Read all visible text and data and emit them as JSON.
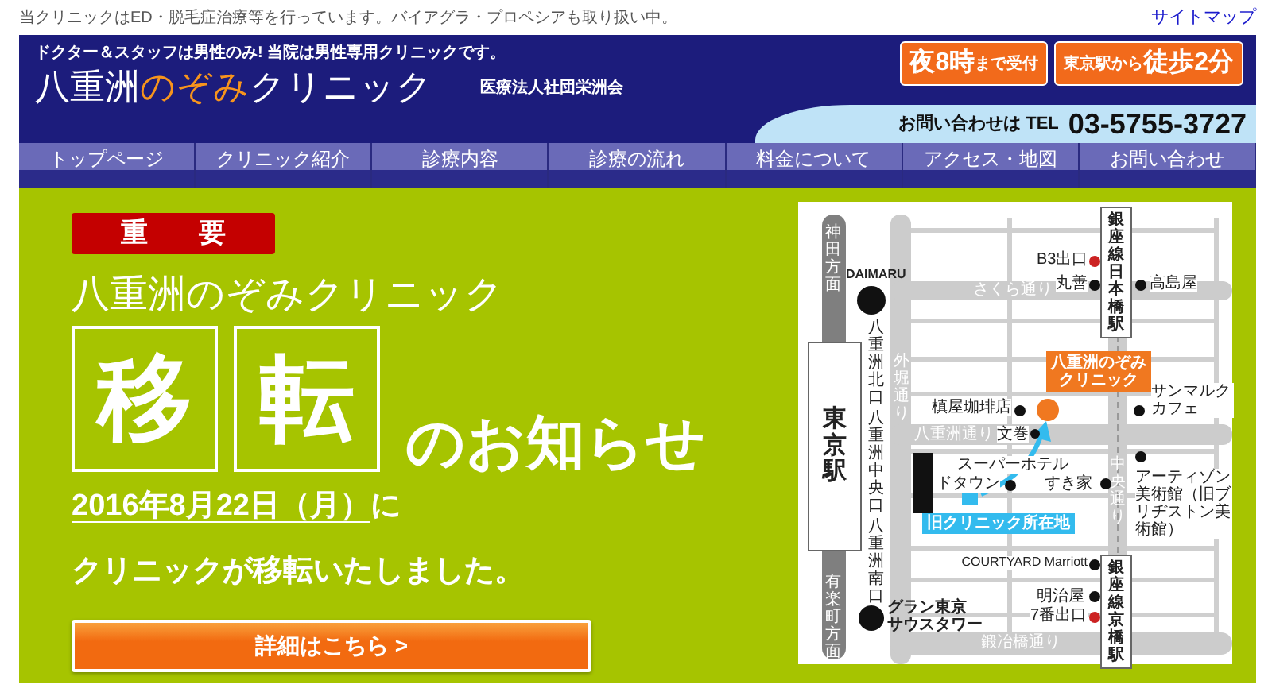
{
  "top_bar": {
    "notice": "当クリニックはED・脱毛症治療等を行っています。バイアグラ・プロペシアも取り扱い中。",
    "sitemap_link": "サイトマップ"
  },
  "header": {
    "tagline": "ドクター＆スタッフは男性のみ! 当院は男性専用クリニックです。",
    "logo": [
      {
        "text": "八重洲",
        "accent": false
      },
      {
        "text": "のぞみ",
        "accent": true
      },
      {
        "text": "クリニック",
        "accent": false
      }
    ],
    "corporation": "医療法人社団栄洲会",
    "badges": [
      {
        "parts": [
          {
            "text": "夜8時",
            "emphasis": true
          },
          {
            "text": "まで受付",
            "emphasis": false
          }
        ]
      },
      {
        "parts": [
          {
            "text": "東京駅から",
            "emphasis": false
          },
          {
            "text": "徒歩2分",
            "emphasis": true
          }
        ]
      }
    ],
    "phone": {
      "label": "お問い合わせは TEL",
      "number": "03-5755-3727"
    }
  },
  "nav": [
    "トップページ",
    "クリニック紹介",
    "診療内容",
    "診療の流れ",
    "料金について",
    "アクセス・地図",
    "お問い合わせ"
  ],
  "banner": {
    "tag": "重 要",
    "clinic_name": "八重洲のぞみクリニック",
    "boxed_chars": [
      "移",
      "転"
    ],
    "headline_rest": "のお知らせ",
    "date": "2016年8月22日（月）",
    "date_suffix": "に",
    "message": "クリニックが移転いたしました。",
    "details_button": "詳細はこちら >",
    "map": {
      "labels": [
        {
          "text": "神田方面",
          "kind": "direction"
        },
        {
          "text": "DAIMARU",
          "kind": "landmark",
          "color": "#111111"
        },
        {
          "text": "八重洲北口",
          "kind": "exit"
        },
        {
          "text": "東京駅",
          "kind": "station-main"
        },
        {
          "text": "八重洲中央口",
          "kind": "exit"
        },
        {
          "text": "八重洲南口",
          "kind": "exit"
        },
        {
          "text": "有楽町方面",
          "kind": "direction"
        },
        {
          "text": "グラン東京",
          "kind": "landmark",
          "color": "#111111"
        },
        {
          "text": "サウスタワー",
          "kind": "landmark"
        },
        {
          "text": "さくら通り",
          "kind": "road"
        },
        {
          "text": "外堀通り",
          "kind": "road-vertical"
        },
        {
          "text": "八重洲通り",
          "kind": "road"
        },
        {
          "text": "中央通り",
          "kind": "road-vertical"
        },
        {
          "text": "鍛冶橋通り",
          "kind": "road"
        },
        {
          "text": "銀座線日本橋駅",
          "kind": "station"
        },
        {
          "text": "B3出口",
          "kind": "place",
          "color": "#cc2222"
        },
        {
          "text": "丸善",
          "kind": "place",
          "color": "#111111"
        },
        {
          "text": "高島屋",
          "kind": "place",
          "color": "#111111"
        },
        {
          "text": "八重洲のぞみクリニック",
          "kind": "clinic",
          "color": "#f07820"
        },
        {
          "text": "槙屋珈琲店",
          "kind": "place",
          "color": "#111111"
        },
        {
          "text": "文巻",
          "kind": "place",
          "color": "#111111"
        },
        {
          "text": "サンマルクカフェ",
          "kind": "place",
          "color": "#111111"
        },
        {
          "text": "スーパーホテル",
          "kind": "place",
          "color": "#111111"
        },
        {
          "text": "ドタウン",
          "kind": "place"
        },
        {
          "text": "すき家",
          "kind": "place",
          "color": "#111111"
        },
        {
          "text": "旧クリニック所在地",
          "kind": "old-site"
        },
        {
          "text": "アーティゾン美術館（旧ブリヂストン美術館）",
          "kind": "place",
          "color": "#111111"
        },
        {
          "text": "COURTYARD Marriott",
          "kind": "place",
          "color": "#111111"
        },
        {
          "text": "明治屋",
          "kind": "place",
          "color": "#111111"
        },
        {
          "text": "7番出口",
          "kind": "place",
          "color": "#cc2222"
        },
        {
          "text": "銀座線京橋駅",
          "kind": "station"
        }
      ]
    }
  }
}
